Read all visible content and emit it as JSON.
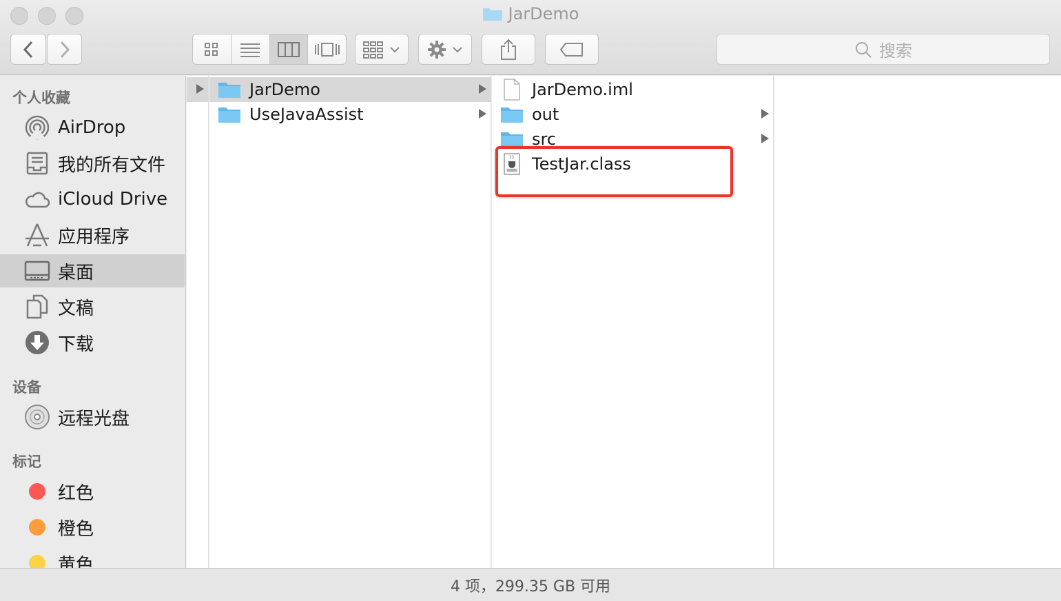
{
  "window": {
    "title": "JarDemo"
  },
  "toolbar": {
    "back_label": "<",
    "forward_label": ">",
    "view_modes": [
      "icons",
      "list",
      "columns",
      "cover-flow"
    ],
    "active_view": "columns",
    "search_placeholder": "搜索"
  },
  "sidebar": {
    "sections": [
      {
        "heading": "个人收藏"
      },
      {
        "heading": "设备"
      },
      {
        "heading": "标记"
      }
    ],
    "favorites": [
      {
        "label": "AirDrop",
        "icon": "airdrop-icon"
      },
      {
        "label": "我的所有文件",
        "icon": "all-files-icon"
      },
      {
        "label": "iCloud Drive",
        "icon": "cloud-icon"
      },
      {
        "label": "应用程序",
        "icon": "applications-icon"
      },
      {
        "label": "桌面",
        "icon": "desktop-icon",
        "selected": true
      },
      {
        "label": "文稿",
        "icon": "documents-icon"
      },
      {
        "label": "下载",
        "icon": "download-icon"
      }
    ],
    "devices": [
      {
        "label": "远程光盘",
        "icon": "disc-icon"
      }
    ],
    "tags": [
      {
        "label": "红色",
        "color": "#fc5753"
      },
      {
        "label": "橙色",
        "color": "#fd9c3b"
      },
      {
        "label": "黄色",
        "color": "#fdd243"
      }
    ]
  },
  "columns": {
    "col1": [
      {
        "name": "JarDemo",
        "kind": "folder",
        "selected": true,
        "has_children": true
      },
      {
        "name": "UseJavaAssist",
        "kind": "folder",
        "has_children": true
      }
    ],
    "col2": [
      {
        "name": "JarDemo.iml",
        "kind": "file"
      },
      {
        "name": "out",
        "kind": "folder",
        "has_children": true
      },
      {
        "name": "src",
        "kind": "folder",
        "has_children": true
      },
      {
        "name": "TestJar.class",
        "kind": "class-file"
      }
    ]
  },
  "colors": {
    "highlight": "#e8362d",
    "folder": "#6cc2f1"
  },
  "status": {
    "text": "4 项，299.35 GB 可用"
  }
}
